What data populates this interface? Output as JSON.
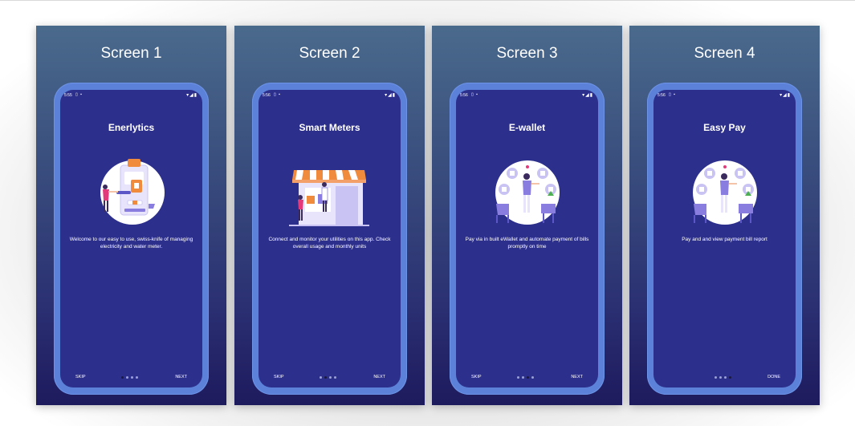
{
  "screens": [
    {
      "label": "Screen 1",
      "status_time": "5:55",
      "title": "Enerlytics",
      "description": "Welcome to our easy to use, swiss-knife of managing electricity and water meter.",
      "left_action": "SKIP",
      "right_action": "NEXT",
      "active_dot": 0,
      "illustration": "meter-app-person-illustration"
    },
    {
      "label": "Screen 2",
      "status_time": "5:56",
      "title": "Smart Meters",
      "description": "Connect and monitor your utilities on this app. Check overall usage and monthly units",
      "left_action": "SKIP",
      "right_action": "NEXT",
      "active_dot": 1,
      "illustration": "shop-storefront-illustration"
    },
    {
      "label": "Screen 3",
      "status_time": "5:56",
      "title": "E-wallet",
      "description": "Pay via in built eWallet and automate payment of bills promptly on time",
      "left_action": "SKIP",
      "right_action": "NEXT",
      "active_dot": 2,
      "illustration": "wallet-person-icons-illustration"
    },
    {
      "label": "Screen 4",
      "status_time": "5:56",
      "title": "Easy Pay",
      "description": "Pay and and view payment bill report",
      "left_action": "",
      "right_action": "DONE",
      "active_dot": 3,
      "illustration": "pay-person-icons-illustration"
    }
  ],
  "status_icons_left": "▯ ▪",
  "status_icons_right": "▾◢▮",
  "colors": {
    "screen_bg": "#2d2f8c",
    "phone_frame": "#5b82d8",
    "accent_orange": "#f08a3c",
    "accent_pink": "#e23a7a",
    "illus_circle": "#ffffff",
    "illus_purple": "#8a7de0"
  }
}
